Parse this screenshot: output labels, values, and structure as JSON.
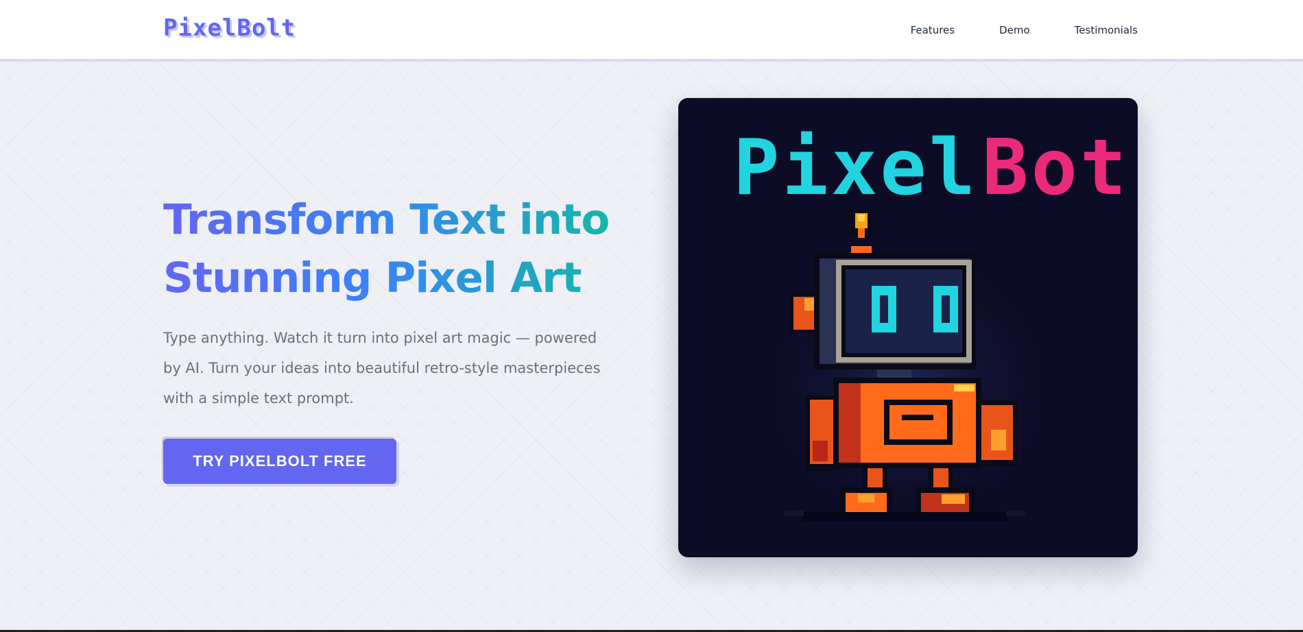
{
  "brand": {
    "name": "PixelBolt",
    "color": "#6366f1"
  },
  "nav": {
    "items": [
      {
        "label": "Features"
      },
      {
        "label": "Demo"
      },
      {
        "label": "Testimonials"
      }
    ]
  },
  "hero": {
    "title_line1": "Transform Text into",
    "title_line2": "Stunning Pixel Art",
    "description": "Type anything. Watch it turn into pixel art magic — powered by AI. Turn your ideas into beautiful retro-style masterpieces with a simple text prompt.",
    "cta_label": "TRY PIXELBOLT FREE",
    "gradient": [
      "#6366f1",
      "#3b82f6",
      "#14b8a6"
    ]
  },
  "showcase": {
    "word1": "Pixel",
    "word2": "Bot",
    "word1_color": "#22d3e0",
    "word2_color": "#ec2a7a",
    "background": "#0d0c26",
    "image": "pixel-robot-illustration"
  }
}
